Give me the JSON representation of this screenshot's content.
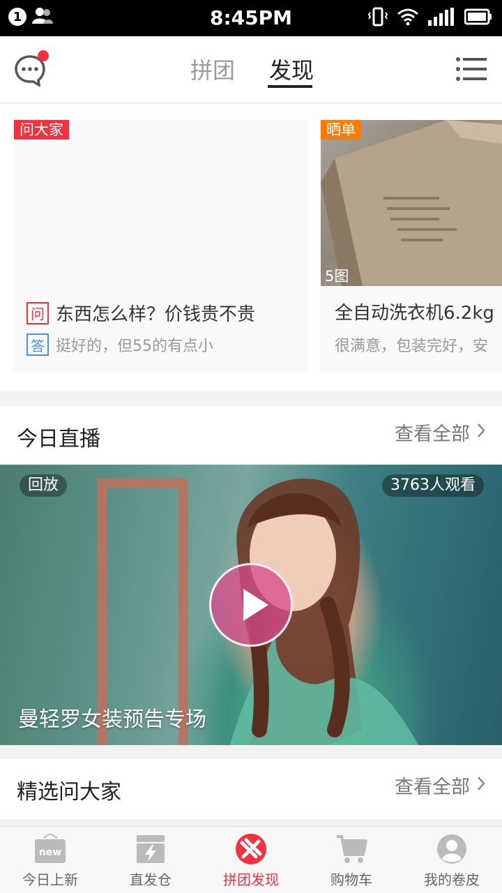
{
  "status_bar": {
    "notification_count": "1",
    "time": "8:45PM"
  },
  "header": {
    "tabs": [
      {
        "label": "拼团"
      },
      {
        "label": "发现"
      }
    ],
    "active_tab": "发现",
    "message_icon": "chat-bubble-icon",
    "menu_icon": "list-menu-icon"
  },
  "cards": [
    {
      "tag": "问大家",
      "question_mark": "问",
      "question": "东西怎么样？价钱贵不贵",
      "answer_mark": "答",
      "answer": "挺好的，但55的有点小"
    },
    {
      "tag": "晒单",
      "image_count": "5图",
      "title": "全自动洗衣机6.2kg",
      "subtitle": "很满意，包装完好，安"
    }
  ],
  "live_section": {
    "title": "今日直播",
    "see_all": "查看全部",
    "banner": {
      "badge": "回放",
      "viewers": "3763人观看",
      "title": "曼轻罗女装预告专场"
    }
  },
  "qa_section": {
    "title": "精选问大家",
    "see_all": "查看全部"
  },
  "bottom_nav": [
    {
      "label": "今日上新",
      "icon": "new-box-icon"
    },
    {
      "label": "直发仓",
      "icon": "lightning-box-icon"
    },
    {
      "label": "拼团发现",
      "icon": "pintuan-logo-icon"
    },
    {
      "label": "购物车",
      "icon": "cart-icon"
    },
    {
      "label": "我的卷皮",
      "icon": "user-avatar-icon"
    }
  ],
  "colors": {
    "accent": "#f2333f",
    "tag_orange": "#ff7a00",
    "answer_blue": "#4a90e2"
  }
}
